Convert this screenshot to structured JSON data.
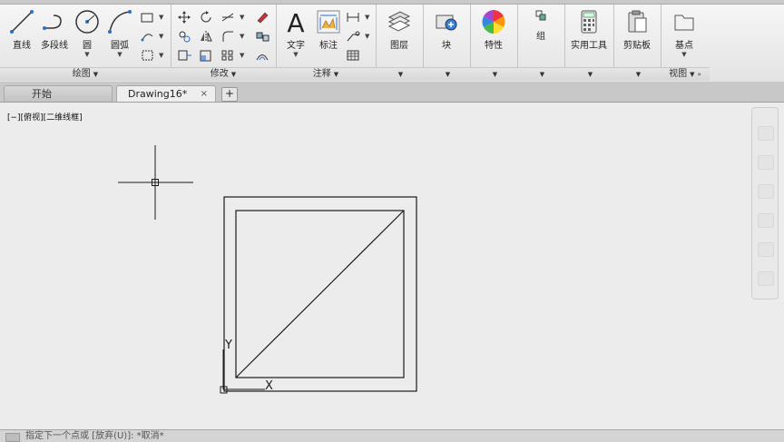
{
  "ribbon": {
    "draw_panel": {
      "title": "绘图",
      "buttons": {
        "line": "直线",
        "polyline": "多段线",
        "circle": "圆",
        "arc": "圆弧"
      }
    },
    "modify_panel": {
      "title": "修改"
    },
    "annotation_panel": {
      "title": "注释",
      "buttons": {
        "text": "文字",
        "dimension": "标注"
      }
    },
    "layers_panel": {
      "label": "图层"
    },
    "block_panel": {
      "label": "块"
    },
    "properties_panel": {
      "label": "特性"
    },
    "groups_panel": {
      "label": "组"
    },
    "utilities_panel": {
      "label": "实用工具"
    },
    "clipboard_panel": {
      "label": "剪贴板"
    },
    "view_panel": {
      "title": "视图",
      "buttons": {
        "base": "基点"
      }
    }
  },
  "tabs": {
    "start": "开始",
    "drawing": "Drawing16*",
    "close_symbol": "×",
    "new_symbol": "+"
  },
  "viewport": {
    "label": "[−][俯视][二维线框]",
    "ucs": {
      "y_label": "Y",
      "x_label": "X"
    }
  },
  "command_line": {
    "text": "指定下一个点或 [放弃(U)]: *取消*"
  },
  "colors": {
    "ribbon_bg": "#e9e9e9",
    "viewport_bg": "#ececec",
    "geometry": "#1a1a1a"
  }
}
